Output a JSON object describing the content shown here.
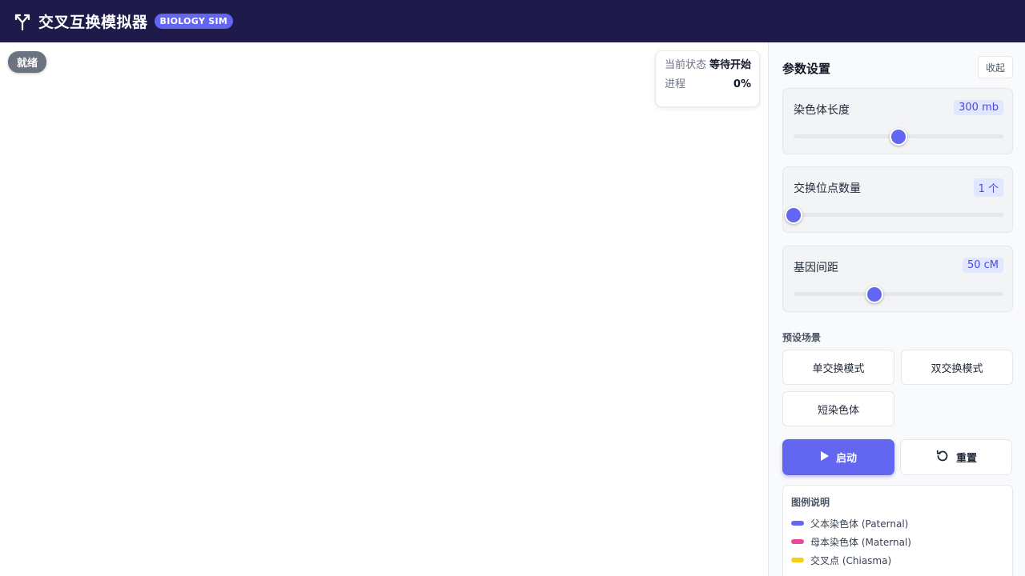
{
  "header": {
    "title": "交叉互换模拟器",
    "badge": "BIOLOGY SIM",
    "icon": "crossover-split-icon"
  },
  "canvas": {
    "state_pill": "就绪",
    "status": {
      "state_label": "当前状态",
      "state_value": "等待开始",
      "progress_label": "进程",
      "progress_value": "0%"
    }
  },
  "panel": {
    "title": "参数设置",
    "collapse_label": "收起",
    "params": [
      {
        "label": "染色体长度",
        "value_text": "300 mb",
        "position": 0.5
      },
      {
        "label": "交换位点数量",
        "value_text": "1 个",
        "position": 0.0
      },
      {
        "label": "基因间距",
        "value_text": "50 cM",
        "position": 0.385
      }
    ],
    "presets_label": "预设场景",
    "presets": [
      "单交换模式",
      "双交换模式",
      "短染色体"
    ],
    "start_label": "启动",
    "reset_label": "重置",
    "legend": {
      "title": "图例说明",
      "items": [
        {
          "label": "父本染色体 (Paternal)",
          "color": "#6366f1"
        },
        {
          "label": "母本染色体 (Maternal)",
          "color": "#ec4899"
        },
        {
          "label": "交叉点 (Chiasma)",
          "color": "#facc15"
        }
      ]
    }
  },
  "colors": {
    "header_bg": "#1e1b4b",
    "accent": "#6366f1"
  }
}
